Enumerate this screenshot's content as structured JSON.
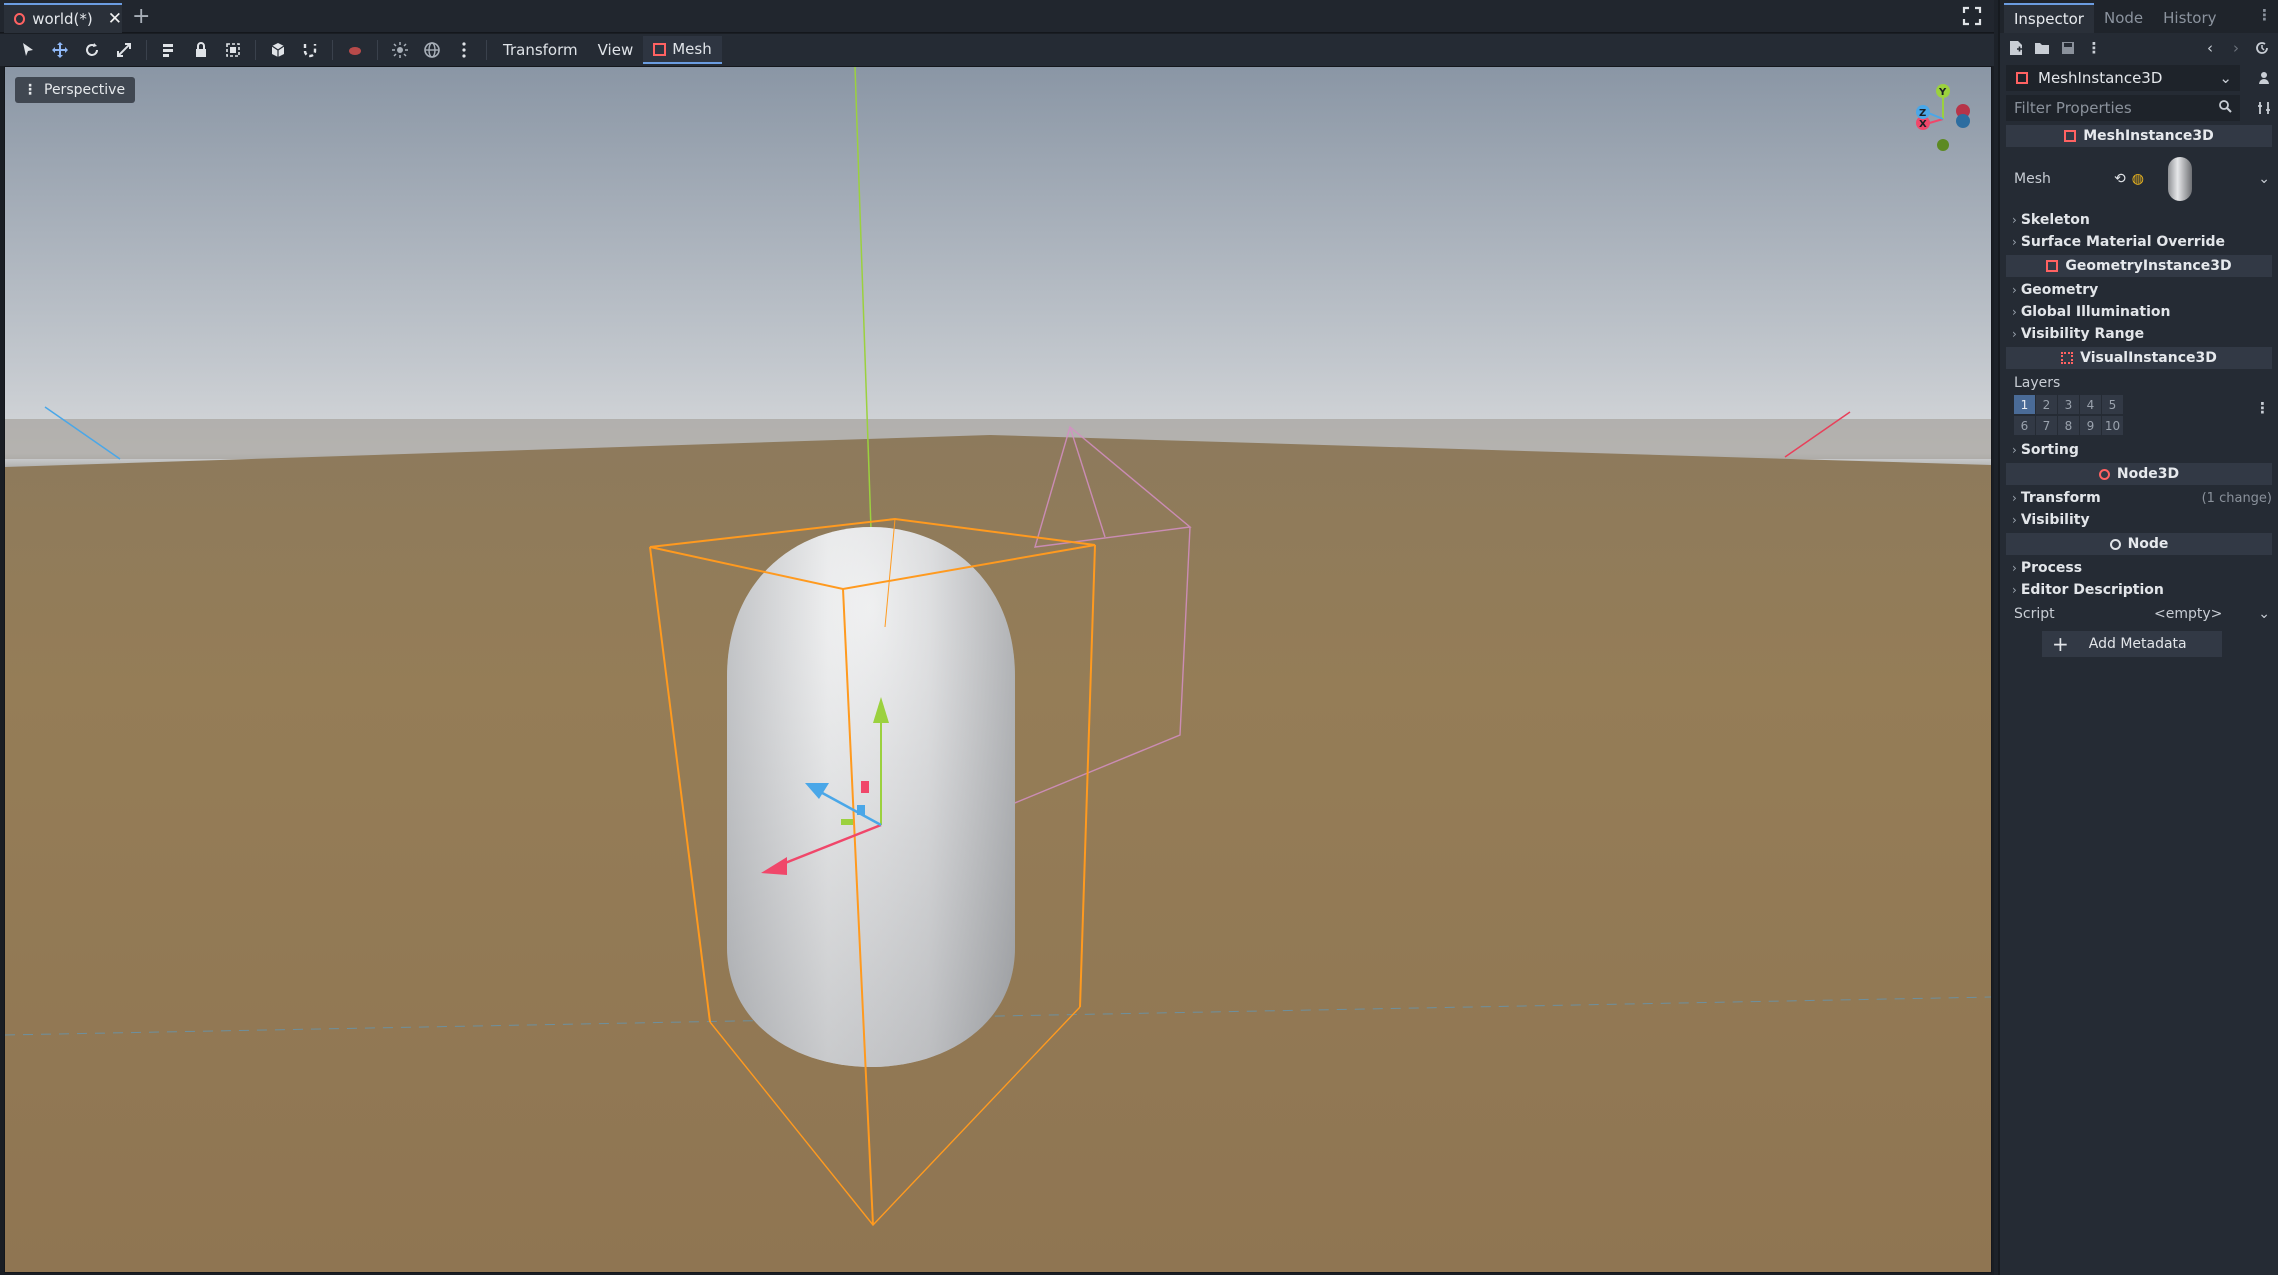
{
  "tab": {
    "title": "world(*)"
  },
  "toolbar": {
    "menus": [
      "Transform",
      "View"
    ],
    "mesh_label": "Mesh"
  },
  "viewport": {
    "perspective_label": "Perspective",
    "gizmo_labels": {
      "y": "Y",
      "x": "X",
      "z": "Z"
    }
  },
  "dock": {
    "tabs": [
      "Inspector",
      "Node",
      "History"
    ],
    "object_select": "MeshInstance3D",
    "filter_placeholder": "Filter Properties",
    "sections": {
      "meshinstance": "MeshInstance3D",
      "geometryinstance": "GeometryInstance3D",
      "visualinstance": "VisualInstance3D",
      "node3d": "Node3D",
      "node": "Node"
    },
    "mesh_label": "Mesh",
    "groups": {
      "skeleton": "Skeleton",
      "surface_material": "Surface Material Override",
      "geometry": "Geometry",
      "global_illumination": "Global Illumination",
      "visibility_range": "Visibility Range",
      "sorting": "Sorting",
      "transform": "Transform",
      "transform_changes": "(1 change)",
      "visibility": "Visibility",
      "process": "Process",
      "editor_description": "Editor Description"
    },
    "layers_label": "Layers",
    "layers": [
      "1",
      "2",
      "3",
      "4",
      "5",
      "6",
      "7",
      "8",
      "9",
      "10"
    ],
    "script_label": "Script",
    "script_value": "<empty>",
    "add_metadata": "Add Metadata"
  },
  "colors": {
    "accent": "#6b9ce0",
    "node_red": "#ff6262",
    "selection_orange": "#ff9a1f"
  }
}
